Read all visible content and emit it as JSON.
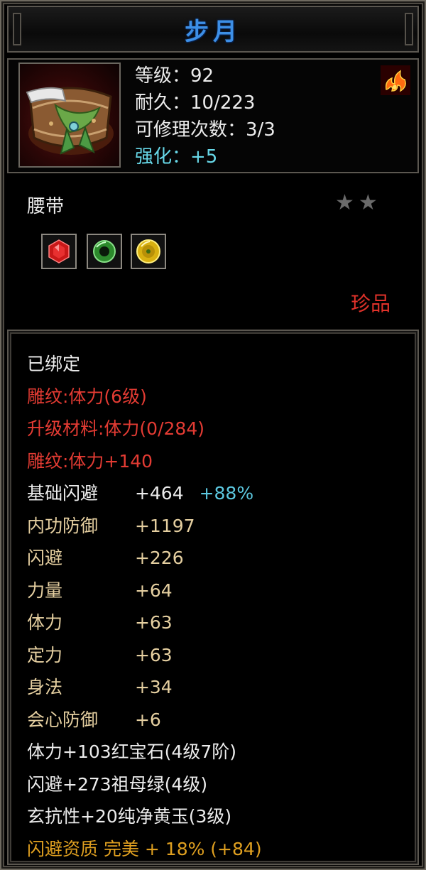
{
  "title": "步月",
  "header": {
    "level": "等级：92",
    "durability": "耐久：10/223",
    "repairs": "可修理次数：3/3",
    "enhance": "强化：+5"
  },
  "item_type": "腰带",
  "stars": [
    "★",
    "★"
  ],
  "quality": "珍品",
  "icons": {
    "item": "belt-icon",
    "element": "fire-element-icon",
    "gems": [
      "ruby-gem-icon",
      "emerald-gem-icon",
      "yellow-jade-gem-icon"
    ]
  },
  "colors": {
    "title": "#3d8fe6",
    "red_text": "#e33b33",
    "gold_text": "#e5cfa0",
    "orange_text": "#e0a020",
    "cyan_text": "#67d8e8"
  },
  "attributes": {
    "bound": "已绑定",
    "engrave1": "雕纹:体力(6级)",
    "upgrade": "升级材料:体力(0/284)",
    "engrave2": "雕纹:体力+140",
    "r1": {
      "label": "基础闪避",
      "value": "+464",
      "extra": "+88%"
    },
    "r2": {
      "label": "内功防御",
      "value": "+1197"
    },
    "r3": {
      "label": "闪避",
      "value": "+226"
    },
    "r4": {
      "label": "力量",
      "value": "+64"
    },
    "r5": {
      "label": "体力",
      "value": "+63"
    },
    "r6": {
      "label": "定力",
      "value": "+63"
    },
    "r7": {
      "label": "身法",
      "value": "+34"
    },
    "r8": {
      "label": "会心防御",
      "value": "+6"
    },
    "gem1": "体力+103红宝石(4级7阶)",
    "gem2": "闪避+273祖母绿(4级)",
    "gem3": "玄抗性+20纯净黄玉(3级)",
    "aptitude": "闪避资质 完美 + 18% (+84)"
  }
}
